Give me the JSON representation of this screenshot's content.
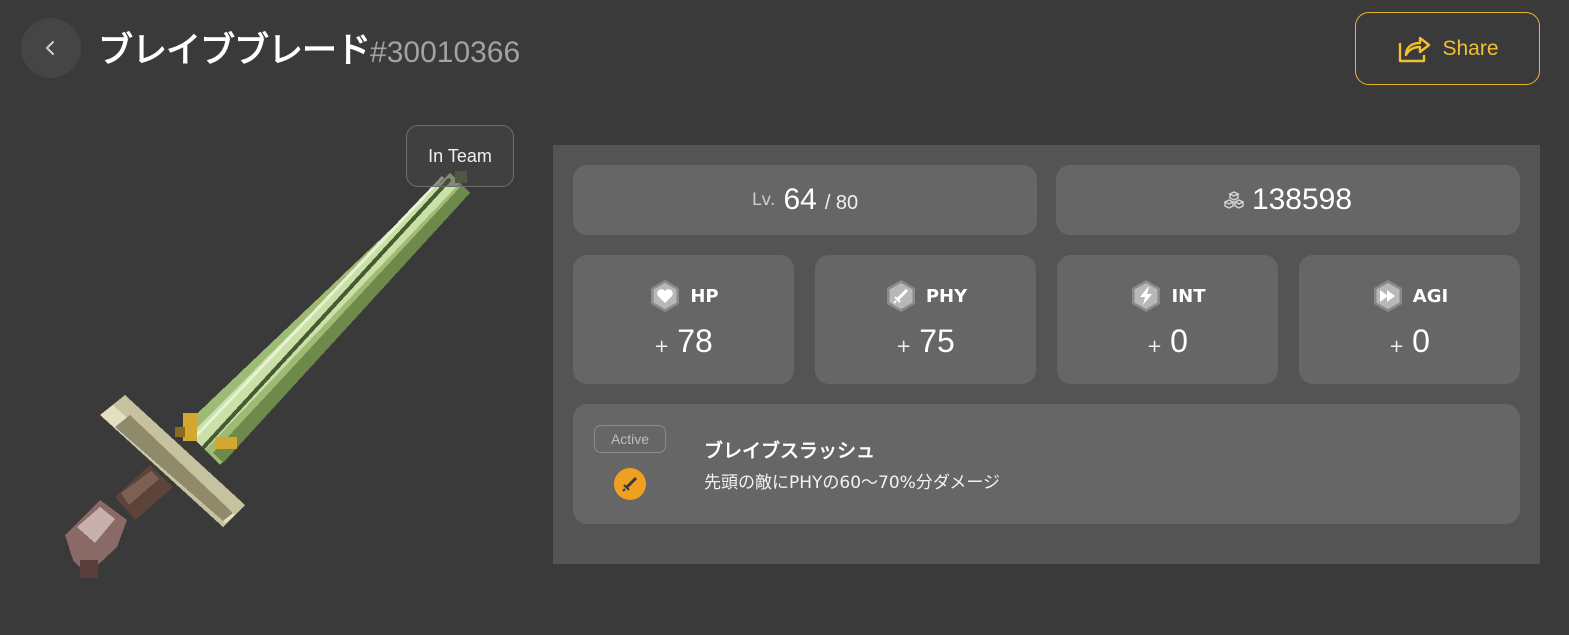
{
  "header": {
    "title": "ブレイブブレード",
    "id": "#30010366",
    "share_label": "Share"
  },
  "item": {
    "badge": "In Team",
    "image_icon": "pixel-sword-icon"
  },
  "level": {
    "prefix": "Lv.",
    "value": "64",
    "max": "/ 80"
  },
  "exp": {
    "icon": "blocks-icon",
    "value": "138598"
  },
  "stats": [
    {
      "label": "HP",
      "plus": "+",
      "value": "78",
      "icon": "heart-icon"
    },
    {
      "label": "PHY",
      "plus": "+",
      "value": "75",
      "icon": "sword-icon"
    },
    {
      "label": "INT",
      "plus": "+",
      "value": "0",
      "icon": "lightning-icon"
    },
    {
      "label": "AGI",
      "plus": "+",
      "value": "0",
      "icon": "fast-forward-icon"
    }
  ],
  "skill": {
    "type": "Active",
    "name": "ブレイブスラッシュ",
    "description": "先頭の敵にPHYの60～70%分ダメージ",
    "icon_color": "#f0a020"
  },
  "colors": {
    "background": "#3a3a3a",
    "panel": "#545454",
    "card": "#666666",
    "accent": "#f0c030"
  }
}
